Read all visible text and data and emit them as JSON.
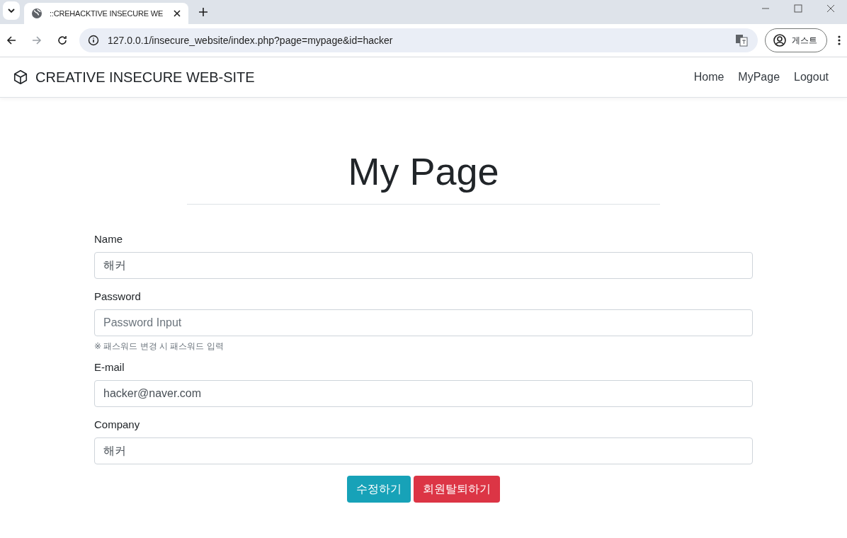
{
  "browser": {
    "tab_title": "::CREHACKTIVE INSECURE WE",
    "url": "127.0.0.1/insecure_website/index.php?page=mypage&id=hacker",
    "profile": "게스트"
  },
  "navbar": {
    "brand": "CREATIVE INSECURE WEB-SITE",
    "links": [
      {
        "label": "Home"
      },
      {
        "label": "MyPage"
      },
      {
        "label": "Logout"
      }
    ]
  },
  "heading": "My Page",
  "fields": [
    {
      "label": "Name",
      "value": "해커"
    },
    {
      "label": "Password",
      "placeholder": "Password Input",
      "help": "※ 패스워드 변경 시 패스워드 입력"
    },
    {
      "label": "E-mail",
      "value": "hacker@naver.com"
    },
    {
      "label": "Company",
      "value": "해커"
    }
  ],
  "buttons": [
    {
      "label": "수정하기",
      "kind": "info"
    },
    {
      "label": "회원탈퇴하기",
      "kind": "danger"
    }
  ]
}
